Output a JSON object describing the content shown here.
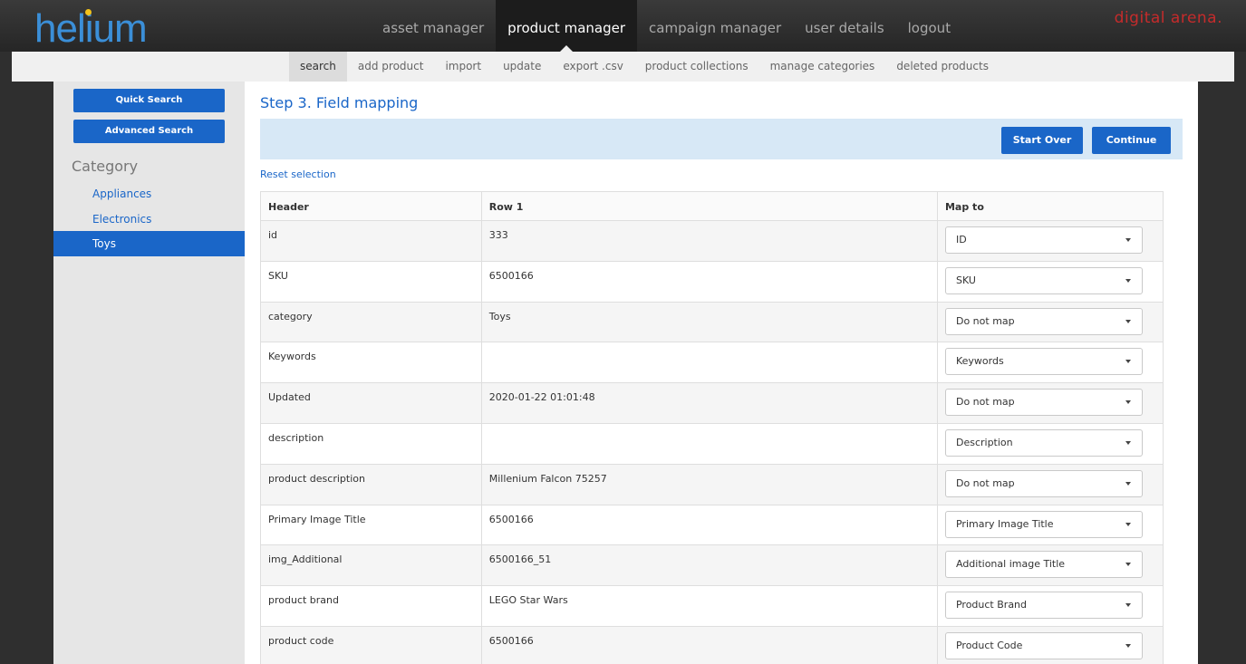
{
  "header": {
    "logo": "helium",
    "nav": [
      "asset manager",
      "product manager",
      "campaign manager",
      "user details",
      "logout"
    ],
    "active_nav": 1,
    "brand": "digital arena."
  },
  "subnav": {
    "items": [
      "search",
      "add product",
      "import",
      "update",
      "export .csv",
      "product collections",
      "manage categories",
      "deleted products"
    ],
    "active": 0
  },
  "sidebar": {
    "quick_search": "Quick Search",
    "advanced_search": "Advanced Search",
    "heading": "Category",
    "categories": [
      "Appliances",
      "Electronics",
      "Toys"
    ],
    "active_category": 2
  },
  "main": {
    "title": "Step 3. Field mapping",
    "start_over": "Start Over",
    "continue": "Continue",
    "reset": "Reset selection",
    "columns": [
      "Header",
      "Row 1",
      "Map to"
    ],
    "rows": [
      {
        "header": "id",
        "row1": "333",
        "map": "ID"
      },
      {
        "header": "SKU",
        "row1": "6500166",
        "map": "SKU"
      },
      {
        "header": "category",
        "row1": "Toys",
        "map": "Do not map"
      },
      {
        "header": "Keywords",
        "row1": "",
        "map": "Keywords"
      },
      {
        "header": "Updated",
        "row1": "2020-01-22 01:01:48",
        "map": "Do not map"
      },
      {
        "header": "description",
        "row1": "",
        "map": "Description"
      },
      {
        "header": "product description",
        "row1": "Millenium Falcon 75257",
        "map": "Do not map"
      },
      {
        "header": "Primary Image Title",
        "row1": "6500166",
        "map": "Primary Image Title"
      },
      {
        "header": "img_Additional",
        "row1": "6500166_51",
        "map": "Additional image Title"
      },
      {
        "header": "product brand",
        "row1": "LEGO Star Wars",
        "map": "Product Brand"
      },
      {
        "header": "product code",
        "row1": "6500166",
        "map": "Product Code"
      }
    ]
  }
}
